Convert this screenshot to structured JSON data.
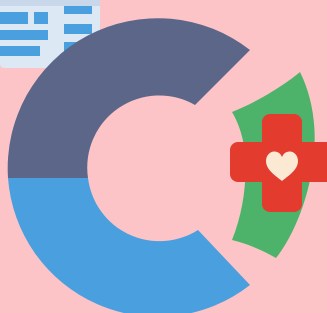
{
  "logo": {
    "icon_name": "health-care-logo-icon",
    "colors": {
      "background": "#FCC4C6",
      "ring_top": "#5B6689",
      "ring_bottom": "#4A9FDE",
      "shield": "#4DB36A",
      "cross": "#E33B2E",
      "heart": "#FCE9D4",
      "document_paper": "#DCE8F4",
      "document_line": "#4A9FDE"
    },
    "parts": [
      "document-icon",
      "ring-top",
      "ring-bottom",
      "shield-icon",
      "medical-cross-icon",
      "heart-icon"
    ]
  }
}
